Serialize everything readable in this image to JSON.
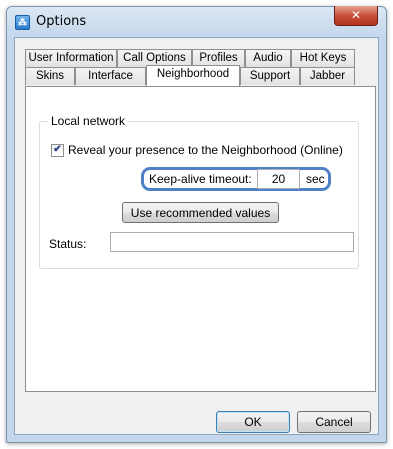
{
  "window": {
    "title": "Options",
    "close_label": "✕"
  },
  "tabs": {
    "row1": [
      {
        "label": "User Information"
      },
      {
        "label": "Call Options"
      },
      {
        "label": "Profiles"
      },
      {
        "label": "Audio"
      },
      {
        "label": "Hot Keys"
      }
    ],
    "row2": [
      {
        "label": "Skins"
      },
      {
        "label": "Interface"
      },
      {
        "label": "Neighborhood",
        "active": true
      },
      {
        "label": "Support"
      },
      {
        "label": "Jabber"
      }
    ]
  },
  "neighborhood": {
    "group_label": "Local network",
    "reveal_checkbox": {
      "label": "Reveal your presence to the Neighborhood (Online)",
      "checked": true
    },
    "keepalive_label": "Keep-alive timeout:",
    "keepalive_value": "20",
    "keepalive_unit": "sec",
    "recommended_button": "Use recommended values",
    "status_label": "Status:",
    "status_value": ""
  },
  "footer": {
    "ok_label": "OK",
    "cancel_label": "Cancel"
  },
  "colors": {
    "highlight_ring": "#4f81c8",
    "close_button": "#c8503b"
  },
  "icons": {
    "app": "options-app-icon",
    "close": "close-icon",
    "check": "checkmark-icon"
  }
}
